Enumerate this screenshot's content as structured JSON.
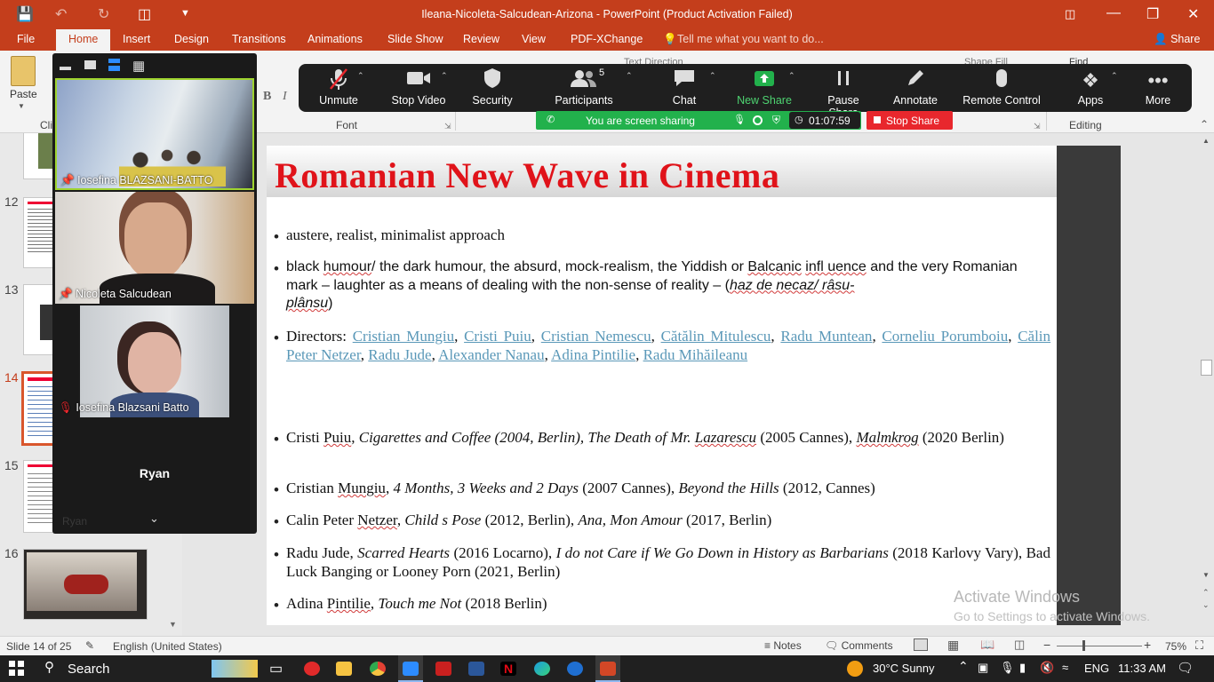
{
  "window": {
    "title": "Ileana-Nicoleta-Salcudean-Arizona - PowerPoint (Product Activation Failed)"
  },
  "ribbon_tabs": [
    "File",
    "Home",
    "Insert",
    "Design",
    "Transitions",
    "Animations",
    "Slide Show",
    "Review",
    "View",
    "PDF-XChange"
  ],
  "tell_me": "Tell me what you want to do...",
  "share_label": "Share",
  "ribbon": {
    "paste_label": "Paste",
    "clipboard_group": "Cli",
    "font_group": "Font",
    "editing_group": "Editing",
    "text_direction": "Text Direction",
    "find": "Find",
    "shape_fill": "Shape Fill"
  },
  "zoom_toolbar": {
    "items": [
      {
        "label": "Unmute",
        "icon": "mic-muted-icon"
      },
      {
        "label": "Stop Video",
        "icon": "camera-icon"
      },
      {
        "label": "Security",
        "icon": "shield-icon"
      },
      {
        "label": "Participants",
        "icon": "participants-icon",
        "count": "5"
      },
      {
        "label": "Chat",
        "icon": "chat-icon"
      },
      {
        "label": "New Share",
        "icon": "share-arrow-icon"
      },
      {
        "label": "Pause Share",
        "icon": "pause-icon"
      },
      {
        "label": "Annotate",
        "icon": "pencil-icon"
      },
      {
        "label": "Remote Control",
        "icon": "mouse-icon"
      },
      {
        "label": "Apps",
        "icon": "apps-icon"
      },
      {
        "label": "More",
        "icon": "more-icon"
      }
    ],
    "sharing_text": "You are screen sharing",
    "timer": "01:07:59",
    "stop_share": "Stop Share",
    "colors": {
      "toolbar": "#1f1f1f",
      "sharing": "#22b14c",
      "stop": "#e8272d",
      "new_share": "#22b14c"
    }
  },
  "video_panel": {
    "participants": [
      {
        "name": "Iosefina BLAZSANI-BATTO",
        "pinned": true
      },
      {
        "name": "Nicoleta Salcudean",
        "pinned": true
      },
      {
        "name": "Iosefina Blazsani Batto",
        "muted": true
      },
      {
        "name": "Ryan"
      }
    ],
    "faded_name": "Ryan"
  },
  "thumbnails": [
    {
      "num": "12"
    },
    {
      "num": "13"
    },
    {
      "num": "14",
      "selected": true
    },
    {
      "num": "15"
    },
    {
      "num": "16"
    }
  ],
  "slide": {
    "title": "Romanian New Wave in Cinema",
    "b1": "austere, realist, minimalist approach",
    "b2": {
      "t1": "black ",
      "s1": "humour",
      "t2": "/ the dark humour, the absurd, mock-realism, the Yiddish or ",
      "s2": "Balcanic",
      "t3": " ",
      "s3": "infl uence",
      "t4": " and the very Romanian mark – laughter as a means of dealing with the non-sense of reality – (",
      "i1": "haz de necaz/ râsu-",
      "i2": "plânsu",
      "t5": ")"
    },
    "b3": {
      "lead": "Directors: ",
      "names": [
        "Cristian Mungiu",
        "Cristi Puiu",
        "Cristian Nemescu",
        "Cătălin Mitulescu",
        "Radu Muntean",
        "Corneliu Porumboiu",
        "Călin Peter Netzer",
        "Radu Jude",
        "Alexander Nanau",
        "Adina Pintilie",
        "Radu Mihăileanu"
      ]
    },
    "b4": {
      "a": "Cristi ",
      "s1": "Puiu",
      "b": ", ",
      "i1": "Cigarettes and Coffee (2004, Berlin), The Death of Mr. ",
      "s2": "Lazarescu",
      "c": " (2005 Cannes), ",
      "s3": "Malmkrog",
      "d": " (2020 Berlin)"
    },
    "b5": {
      "a": "Cristian ",
      "s1": "Mungiu",
      "b": ", ",
      "i1": "4 Months, 3 Weeks and 2 Days",
      "c": " (2007 Cannes), ",
      "i2": "Beyond the Hills",
      "d": " (2012, Cannes)"
    },
    "b6": {
      "a": "Calin Peter ",
      "s1": "Netzer",
      "b": ", ",
      "i1": "Child s Pose",
      "c": " (2012, Berlin), ",
      "i2": "Ana, Mon Amour",
      "d": " (2017, Berlin)"
    },
    "b7": {
      "a": "Radu Jude, ",
      "i1": "Scarred Hearts",
      "b": " (2016 Locarno), ",
      "i2": "I do not Care if We Go Down in History as Barbarians",
      "c": " (2018 Karlovy Vary), Bad Luck Banging or Looney Porn (2021, Berlin)"
    },
    "b8": {
      "a": "Adina ",
      "s1": "Pintilie",
      "b": ", ",
      "i1": "Touch me Not",
      "c": " (2018 Berlin)"
    }
  },
  "watermark": {
    "line1": "Activate Windows",
    "line2": "Go to Settings to activate Windows."
  },
  "status": {
    "slide": "Slide 14 of 25",
    "lang": "English (United States)",
    "notes": "Notes",
    "comments": "Comments",
    "zoom": "75%"
  },
  "taskbar": {
    "search": "Search",
    "weather": "30°C  Sunny",
    "lang": "ENG",
    "time": "11:33 AM"
  }
}
